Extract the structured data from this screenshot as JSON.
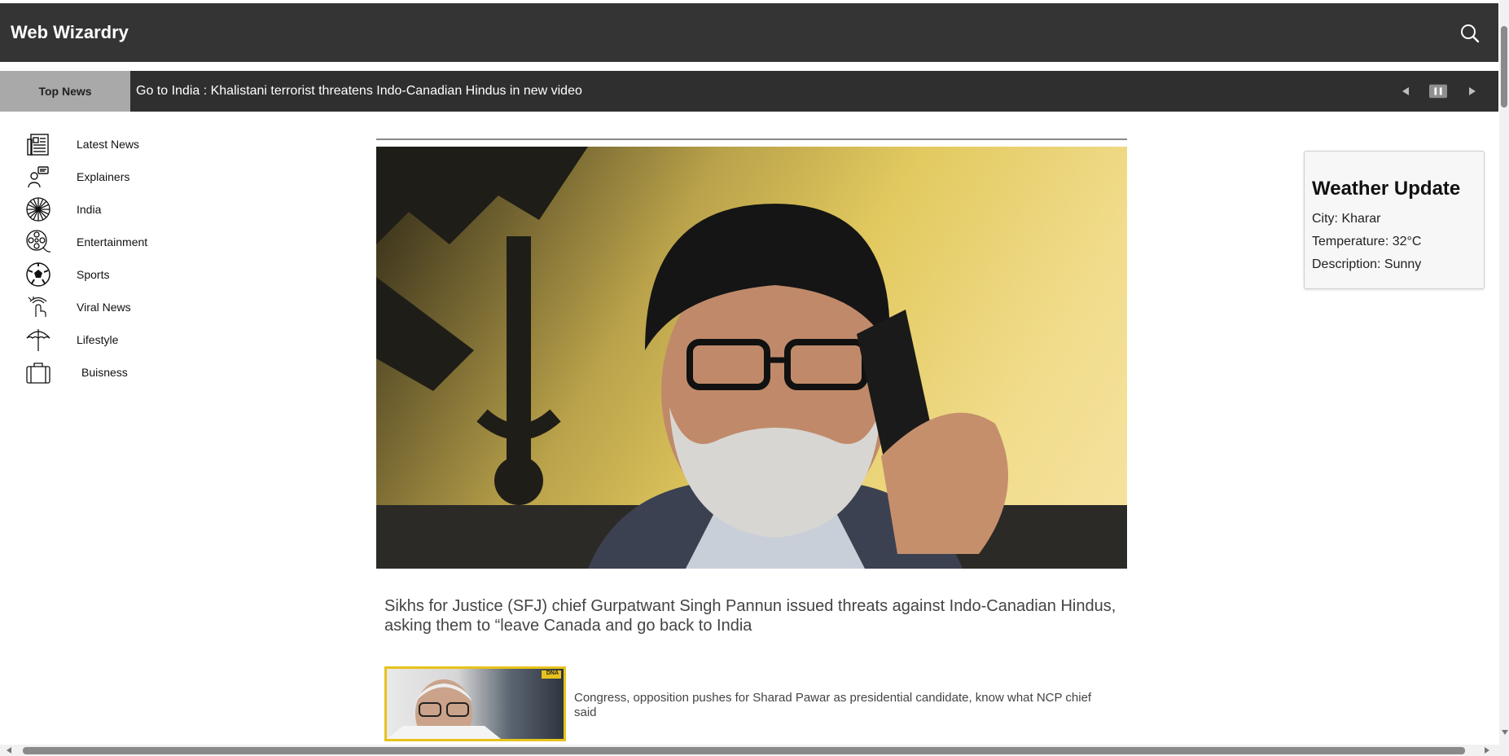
{
  "header": {
    "brand": "Web Wizardry",
    "search_icon": "search-icon"
  },
  "ticker": {
    "label": "Top News",
    "headline": "Go to India : Khalistani terrorist threatens Indo-Canadian Hindus in new video",
    "controls": [
      "prev-icon",
      "pause-icon",
      "next-icon"
    ]
  },
  "sidebar": {
    "items": [
      {
        "label": "Latest News",
        "icon": "newspaper-icon"
      },
      {
        "label": "Explainers",
        "icon": "speaker-icon"
      },
      {
        "label": "India",
        "icon": "chakra-icon"
      },
      {
        "label": "Entertainment",
        "icon": "film-reel-icon"
      },
      {
        "label": "Sports",
        "icon": "football-icon"
      },
      {
        "label": "Viral News",
        "icon": "viral-icon"
      },
      {
        "label": "Lifestyle",
        "icon": "umbrella-icon"
      },
      {
        "label": "Buisness",
        "icon": "briefcase-icon"
      }
    ]
  },
  "main": {
    "headline": "Sikhs for Justice (SFJ) chief Gurpatwant Singh Pannun issued threats against Indo-Canadian Hindus, asking them to “leave Canada and go back to India",
    "stories": [
      {
        "title": "Congress, opposition pushes for Sharad Pawar as presidential candidate, know what NCP chief said",
        "badge": "DNA"
      }
    ]
  },
  "weather": {
    "title": "Weather Update",
    "city": "City: Kharar",
    "temperature": "Temperature: 32°C",
    "description": "Description: Sunny"
  },
  "colors": {
    "topbar": "#343434",
    "ticker_bg": "#2f2f2f",
    "ticker_label_bg": "#a9a9a9",
    "accent_yellow": "#e7c21c"
  }
}
